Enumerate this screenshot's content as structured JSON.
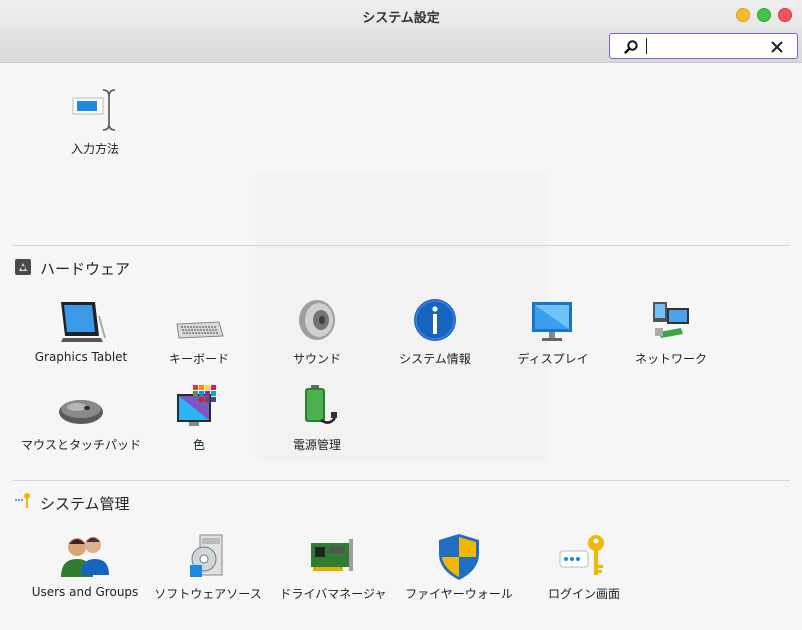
{
  "window": {
    "title": "システム設定"
  },
  "search": {
    "value": "",
    "placeholder": ""
  },
  "top_items": [
    {
      "label": "入力方法",
      "icon": "input-method-icon"
    }
  ],
  "sections": [
    {
      "title": "ハードウェア",
      "icon": "hardware-icon",
      "items": [
        {
          "label": "Graphics Tablet",
          "icon": "graphics-tablet-icon"
        },
        {
          "label": "キーボード",
          "icon": "keyboard-icon"
        },
        {
          "label": "サウンド",
          "icon": "speaker-icon"
        },
        {
          "label": "システム情報",
          "icon": "info-icon"
        },
        {
          "label": "ディスプレイ",
          "icon": "display-icon"
        },
        {
          "label": "ネットワーク",
          "icon": "network-icon"
        },
        {
          "label": "マウスとタッチパッド",
          "icon": "mouse-icon"
        },
        {
          "label": "色",
          "icon": "color-icon"
        },
        {
          "label": "電源管理",
          "icon": "battery-icon"
        }
      ]
    },
    {
      "title": "システム管理",
      "icon": "administration-key-icon",
      "items": [
        {
          "label": "Users and Groups",
          "icon": "users-icon"
        },
        {
          "label": "ソフトウェアソース",
          "icon": "software-sources-icon"
        },
        {
          "label": "ドライバマネージャ",
          "icon": "driver-card-icon"
        },
        {
          "label": "ファイヤーウォール",
          "icon": "firewall-shield-icon"
        },
        {
          "label": "ログイン画面",
          "icon": "login-key-icon"
        }
      ]
    }
  ],
  "colors": {
    "accent": "#7b63c8",
    "info_blue": "#1565c0",
    "shield_blue": "#1e6fc2",
    "shield_yellow": "#f2b705"
  }
}
